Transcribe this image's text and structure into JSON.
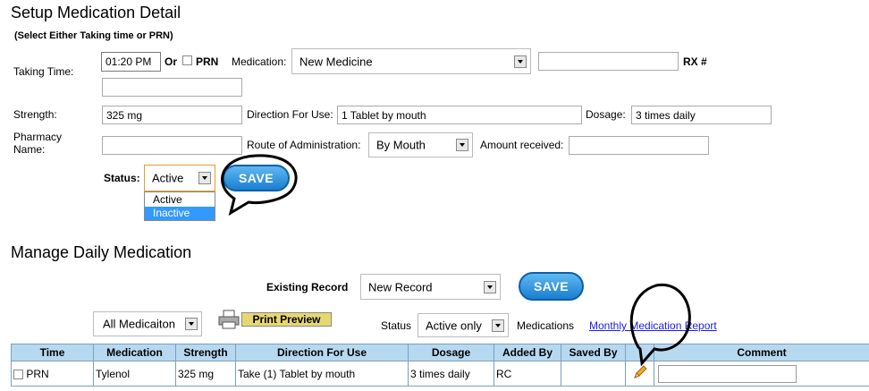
{
  "setup": {
    "title": "Setup Medication Detail",
    "subtitle": "(Select Either Taking time or PRN)",
    "taking_time_label": "Taking Time:",
    "taking_time_value": "01:20 PM",
    "or_label": "Or",
    "prn_label": "PRN",
    "medication_label": "Medication:",
    "medication_value": "New Medicine",
    "rx_label": "RX #",
    "rx_value": "",
    "strength_label": "Strength:",
    "strength_value": "325 mg",
    "direction_label": "Direction For Use:",
    "direction_value": "1 Tablet by mouth",
    "dosage_label": "Dosage:",
    "dosage_value": "3 times daily",
    "pharmacy_label_1": "Pharmacy",
    "pharmacy_label_2": "Name:",
    "pharmacy_value": "",
    "route_label": "Route of Administration:",
    "route_value": "By Mouth",
    "amount_label": "Amount received:",
    "amount_value": "",
    "status_label": "Status:",
    "status_value": "Active",
    "status_options": [
      "Active",
      "Inactive"
    ],
    "save_label": "SAVE"
  },
  "manage": {
    "title": "Manage Daily Medication",
    "existing_label": "Existing Record",
    "existing_value": "New Record",
    "save_label": "SAVE",
    "filter_value": "All Medicaiton",
    "print_label": "Print  Preview",
    "status_label": "Status",
    "status_value": "Active only",
    "medications_label": "Medications",
    "report_link": "Monthly Medication Report"
  },
  "table": {
    "headers": [
      "Time",
      "Medication",
      "Strength",
      "Direction For Use",
      "Dosage",
      "Added By",
      "Saved By",
      "",
      "Comment"
    ],
    "rows": [
      {
        "time": "PRN",
        "medication": "Tylenol",
        "strength": "325 mg",
        "direction": "Take (1) Tablet by mouth",
        "dosage": "3 times daily",
        "added_by": "RC",
        "saved_by": "",
        "comment": ""
      }
    ]
  },
  "icons": {
    "edit": "pencil-icon",
    "print": "printer-icon",
    "dropdown": "chevron-down-icon"
  },
  "colors": {
    "header_bg": "#b7d9f0",
    "save_button": "#1a7fd0",
    "link": "#1a1aee",
    "selected_option": "#3399ff"
  }
}
